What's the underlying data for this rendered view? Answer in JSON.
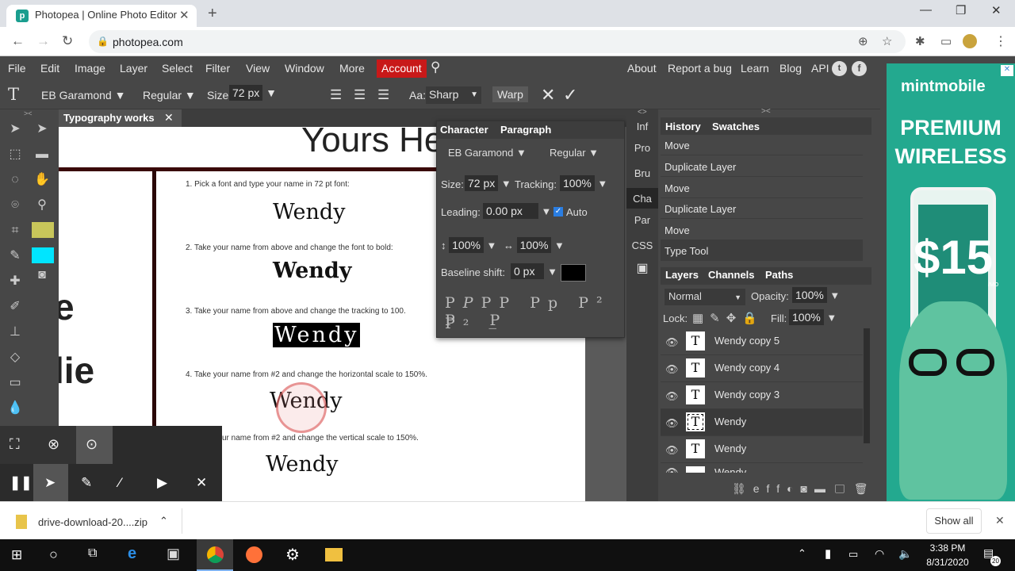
{
  "browser": {
    "tab_title": "Photopea | Online Photo Editor",
    "url": "photopea.com"
  },
  "menu": {
    "items": [
      "File",
      "Edit",
      "Image",
      "Layer",
      "Select",
      "Filter",
      "View",
      "Window",
      "More"
    ],
    "account": "Account",
    "right": [
      "About",
      "Report a bug",
      "Learn",
      "Blog",
      "API"
    ]
  },
  "options": {
    "font": "EB Garamond",
    "style": "Regular",
    "size_label": "Size:",
    "size": "72 px",
    "aa_label": "Aa:",
    "aa": "Sharp",
    "warp": "Warp"
  },
  "doc": {
    "tab": "Typography works",
    "heading": "Yours He",
    "side_text": [
      "e",
      "lie"
    ],
    "lines": [
      {
        "instr": "1. Pick a font and type your name in 72 pt font:",
        "word": "Wendy"
      },
      {
        "instr": "2. Take your name from above and change the font to bold:",
        "word": "Wendy"
      },
      {
        "instr": "3.  Take your name from above and change the tracking to 100.",
        "word": "Wendy"
      },
      {
        "instr": "4. Take your name from #2 and change the horizontal scale to 150%.",
        "word": "Wendy"
      },
      {
        "instr": "ur name from #2 and change the vertical scale to 150%.",
        "word": "Wendy"
      }
    ]
  },
  "character": {
    "tab1": "Character",
    "tab2": "Paragraph",
    "font": "EB Garamond",
    "style": "Regular",
    "size_label": "Size:",
    "size": "72 px",
    "tracking_label": "Tracking:",
    "tracking": "100%",
    "leading_label": "Leading:",
    "leading": "0.00 px",
    "auto": "Auto",
    "vscale": "100%",
    "hscale": "100%",
    "baseline_label": "Baseline shift:",
    "baseline": "0 px"
  },
  "side_tabs": [
    "Inf",
    "Pro",
    "Bru",
    "Cha",
    "Par",
    "CSS"
  ],
  "history": {
    "tab1": "History",
    "tab2": "Swatches",
    "items": [
      "Move",
      "Duplicate Layer",
      "Move",
      "Duplicate Layer",
      "Move",
      "Type Tool"
    ]
  },
  "layers": {
    "tabs": [
      "Layers",
      "Channels",
      "Paths"
    ],
    "blend": "Normal",
    "opacity_label": "Opacity:",
    "opacity": "100%",
    "lock_label": "Lock:",
    "fill_label": "Fill:",
    "fill": "100%",
    "items": [
      "Wendy copy 5",
      "Wendy copy 4",
      "Wendy copy 3",
      "Wendy",
      "Wendy",
      "Wendy"
    ]
  },
  "ad": {
    "brand": "mintmobile",
    "line1": "PREMIUM",
    "line2": "WIRELESS",
    "price": "$15",
    "mo": "/MO"
  },
  "download": {
    "file": "drive-download-20....zip",
    "show_all": "Show all"
  },
  "taskbar": {
    "time": "3:38 PM",
    "date": "8/31/2020",
    "notif": "20"
  }
}
